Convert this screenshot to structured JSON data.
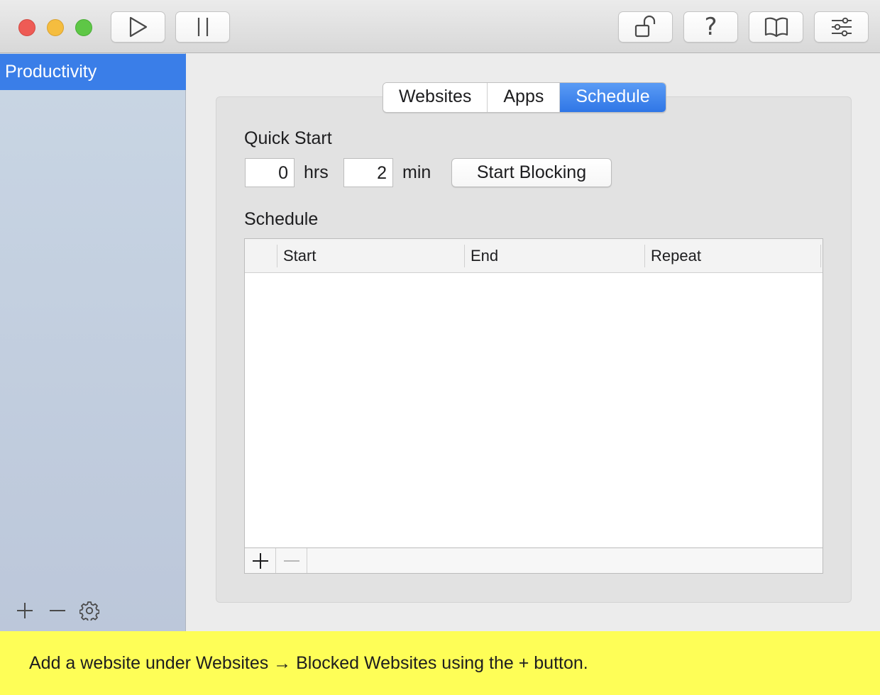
{
  "window": {
    "buttons": {
      "start": "play-icon",
      "pause": "pause-icon",
      "unlock": "unlock-icon",
      "help": "?",
      "book": "book-icon",
      "preferences": "sliders-icon"
    }
  },
  "sidebar": {
    "items": [
      {
        "label": "Productivity",
        "selected": true
      }
    ],
    "controls": [
      "plus-icon",
      "minus-icon",
      "gear-icon"
    ]
  },
  "tabs": [
    {
      "label": "Websites",
      "active": false
    },
    {
      "label": "Apps",
      "active": false
    },
    {
      "label": "Schedule",
      "active": true
    }
  ],
  "quick_start": {
    "heading": "Quick Start",
    "hours_value": "0",
    "hours_unit": "hrs",
    "minutes_value": "2",
    "minutes_unit": "min",
    "start_button": "Start Blocking"
  },
  "schedule": {
    "heading": "Schedule",
    "columns": [
      "Start",
      "End",
      "Repeat"
    ],
    "rows": []
  },
  "hint": {
    "text": "Add a website under Websites → Blocked Websites using the + button."
  },
  "colors": {
    "accent": "#3a7ee8",
    "hint_background": "#fefe57"
  }
}
